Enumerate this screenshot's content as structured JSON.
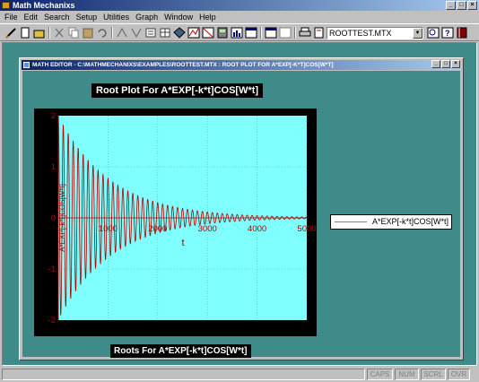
{
  "app": {
    "title": "Math Mechanixs"
  },
  "menu": [
    "File",
    "Edit",
    "Search",
    "Setup",
    "Utilities",
    "Graph",
    "Window",
    "Help"
  ],
  "toolbar": {
    "file_combo_value": "ROOTTEST.MTX"
  },
  "mdi": {
    "title": "MATH EDITOR - C:\\MATHMECHANIXS\\EXAMPLES\\ROOTTEST.MTX : ROOT PLOT FOR A*EXP[-K*T]COS[W*T]"
  },
  "plot": {
    "title": "Root Plot For A*EXP[-k*t]COS[W*t]",
    "footer": "Roots For A*EXP[-k*t]COS[W*t]",
    "legend_label": "A*EXP[-k*t]COS[W*t]"
  },
  "status": [
    "CAPS",
    "NUM",
    "SCRL",
    "OVR"
  ],
  "colors": {
    "plot_bg": "#80ffff",
    "curve": "#b00000",
    "workspace": "#3f8b89",
    "titlebar": "#0a246a"
  },
  "chart_data": {
    "type": "line",
    "title": "Root Plot For A*EXP[-k*t]COS[W*t]",
    "xlabel": "t",
    "ylabel": "A*EXP[-k*t]COS[W*t]",
    "xlim": [
      0,
      5000
    ],
    "ylim": [
      -2,
      2
    ],
    "x_ticks": [
      "1000",
      "2000",
      "3000",
      "4000",
      "5000"
    ],
    "y_ticks": [
      "2",
      "1",
      "0",
      "-1",
      "-2"
    ],
    "grid": true,
    "legend": "right",
    "series": [
      {
        "name": "A*EXP[-k*t]COS[W*t]",
        "amplitude": 2,
        "decay_rate": 0.00095,
        "period": 100,
        "samples": [
          [
            0,
            2.0
          ],
          [
            50,
            -1.9
          ],
          [
            100,
            1.82
          ],
          [
            150,
            -1.73
          ],
          [
            200,
            1.65
          ],
          [
            500,
            1.24
          ],
          [
            1000,
            0.77
          ],
          [
            1500,
            0.48
          ],
          [
            2000,
            0.3
          ],
          [
            2500,
            0.19
          ],
          [
            3000,
            0.12
          ],
          [
            3500,
            0.07
          ],
          [
            4000,
            0.04
          ],
          [
            4500,
            0.03
          ],
          [
            5000,
            0.02
          ]
        ]
      }
    ]
  }
}
